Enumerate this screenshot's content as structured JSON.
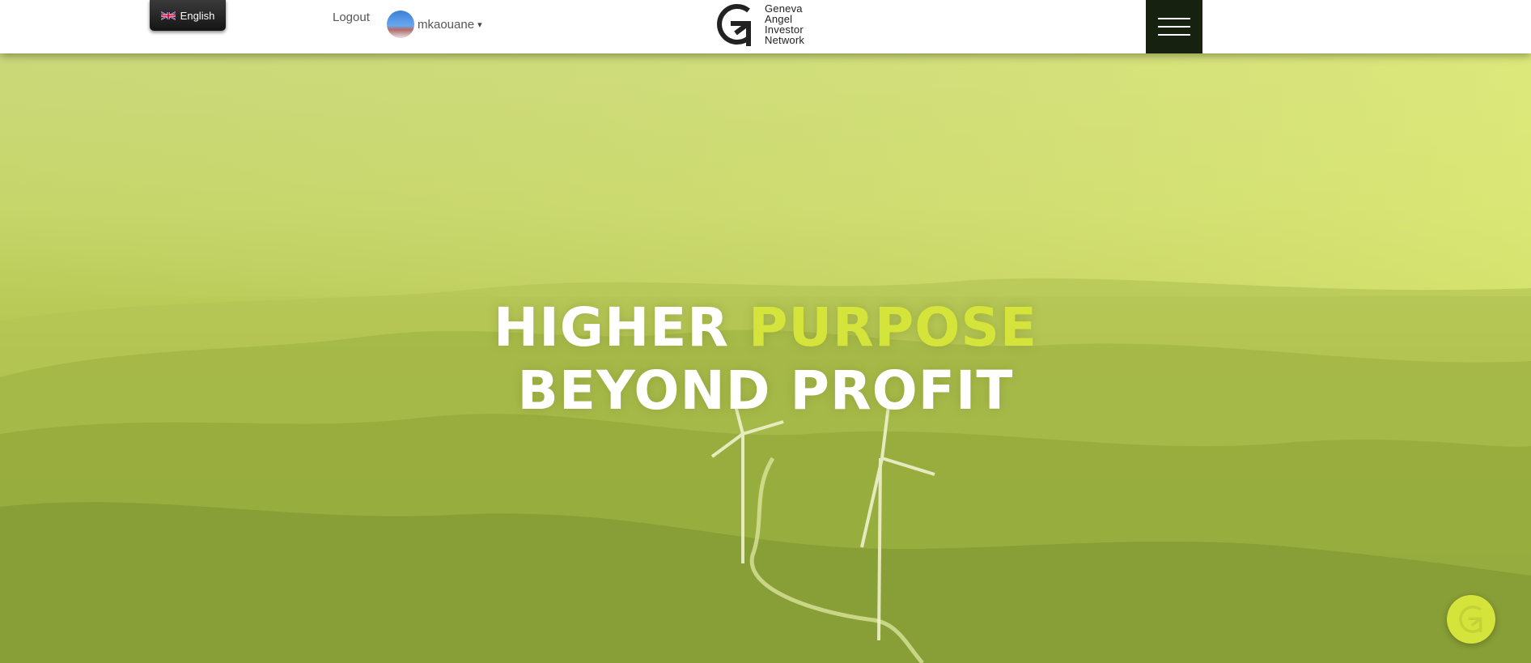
{
  "header": {
    "language": {
      "label": "English",
      "flag": "uk-flag-icon"
    },
    "logout_label": "Logout",
    "user": {
      "name": "mkaouane",
      "chevron": "chevron-down-icon"
    },
    "logo": {
      "lines": [
        "Geneva",
        "Angel",
        "Investor",
        "Network"
      ]
    },
    "menu_icon": "hamburger-menu-icon"
  },
  "hero": {
    "line1_white": "HIGHER",
    "line1_accent": "PURPOSE",
    "line2": "BEYOND PROFIT",
    "accent_color": "#d4e43a"
  },
  "chat_button": {
    "icon": "gain-logo-icon"
  }
}
